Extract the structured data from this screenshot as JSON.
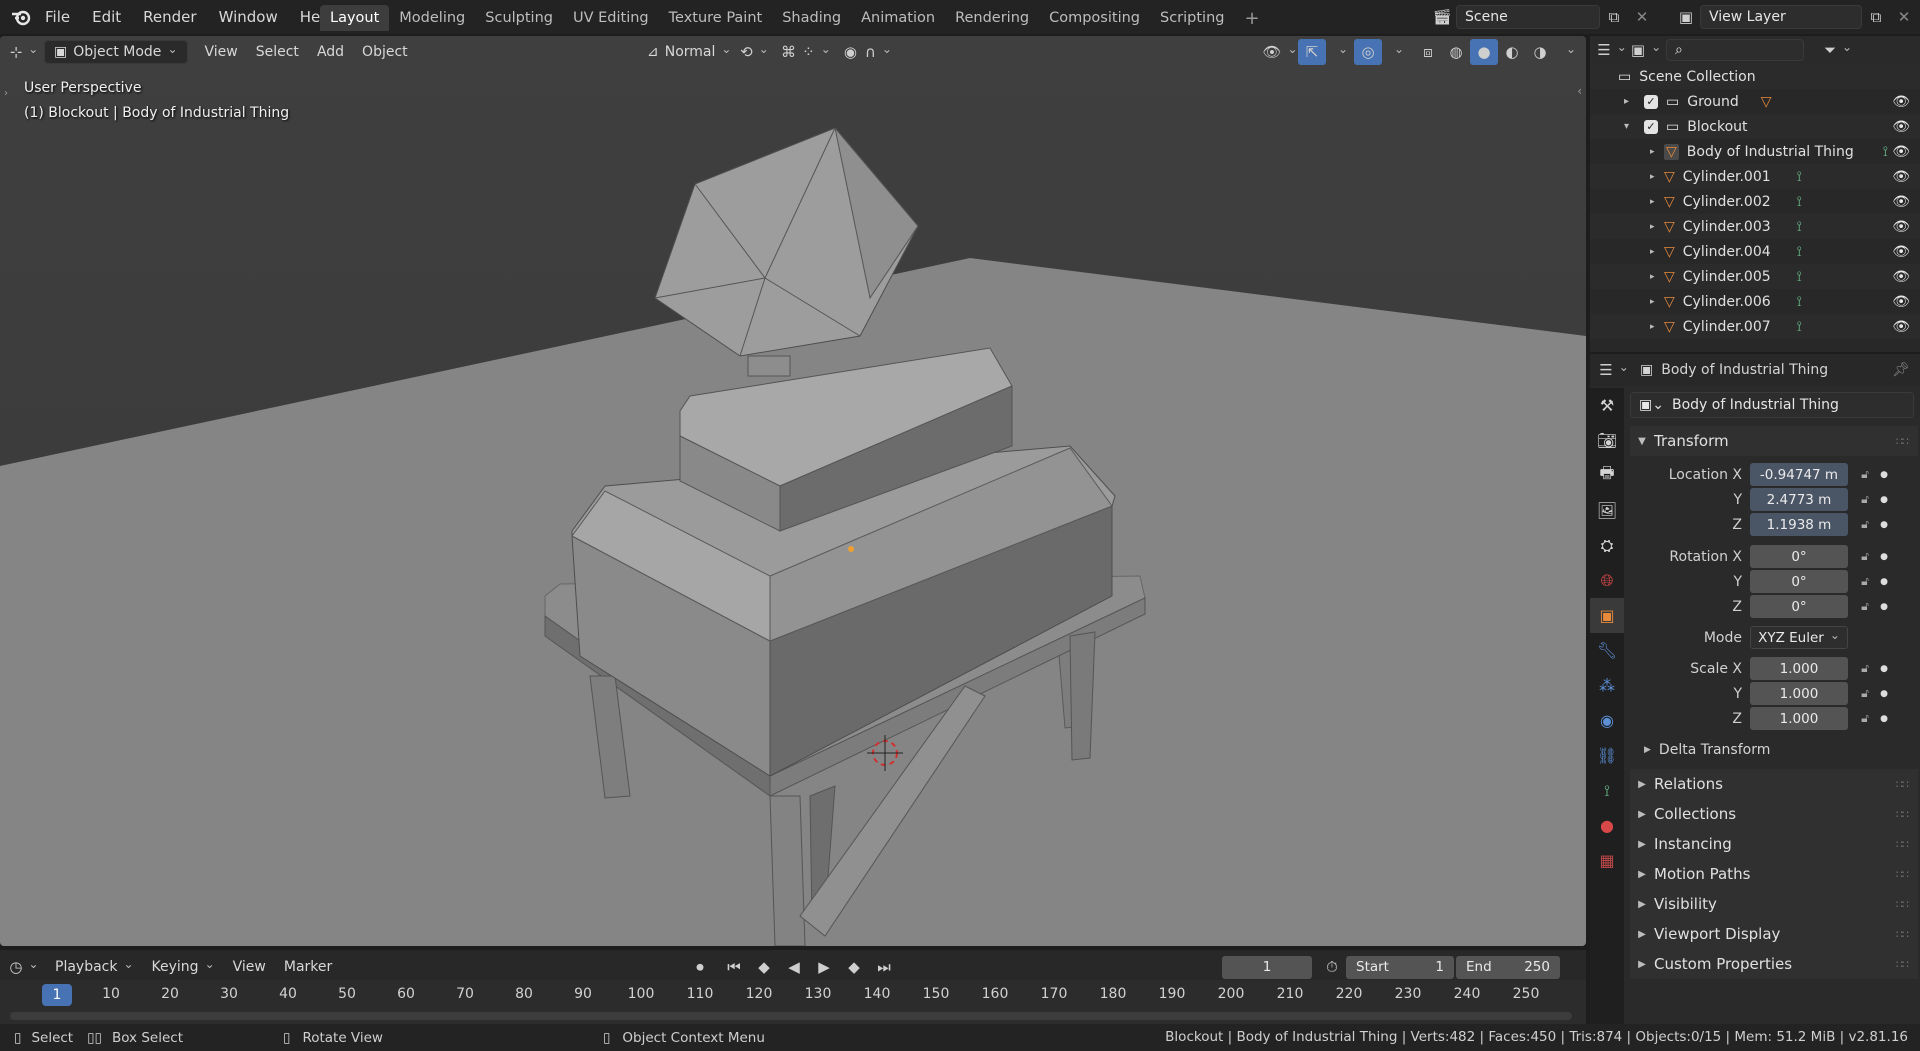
{
  "app": {
    "logo": "blender-logo-icon"
  },
  "menu": [
    "File",
    "Edit",
    "Render",
    "Window",
    "Help"
  ],
  "workspaces": [
    "Layout",
    "Modeling",
    "Sculpting",
    "UV Editing",
    "Texture Paint",
    "Shading",
    "Animation",
    "Rendering",
    "Compositing",
    "Scripting"
  ],
  "active_workspace": "Layout",
  "scene": {
    "name": "Scene",
    "view_layer": "View Layer"
  },
  "viewport": {
    "mode": "Object Mode",
    "menus": [
      "View",
      "Select",
      "Add",
      "Object"
    ],
    "orientation": "Normal",
    "perspective": "User Perspective",
    "active_info": "(1) Blockout | Body of Industrial Thing"
  },
  "outliner": {
    "root": "Scene Collection",
    "collections": [
      {
        "name": "Ground",
        "expanded": false
      },
      {
        "name": "Blockout",
        "expanded": true
      }
    ],
    "objects": [
      "Body of Industrial Thing",
      "Cylinder.001",
      "Cylinder.002",
      "Cylinder.003",
      "Cylinder.004",
      "Cylinder.005",
      "Cylinder.006",
      "Cylinder.007"
    ]
  },
  "properties": {
    "object_name": "Body of Industrial Thing",
    "data_name": "Body of Industrial Thing",
    "transform_title": "Transform",
    "location": {
      "label": "Location X",
      "x": "-0.94747 m",
      "y": "2.4773 m",
      "z": "1.1938 m"
    },
    "rotation": {
      "label": "Rotation X",
      "x": "0°",
      "y": "0°",
      "z": "0°"
    },
    "mode_label": "Mode",
    "mode_value": "XYZ Euler",
    "scale": {
      "label": "Scale X",
      "x": "1.000",
      "y": "1.000",
      "z": "1.000"
    },
    "axis_y": "Y",
    "axis_z": "Z",
    "delta": "Delta Transform",
    "panels": [
      "Relations",
      "Collections",
      "Instancing",
      "Motion Paths",
      "Visibility",
      "Viewport Display",
      "Custom Properties"
    ]
  },
  "timeline": {
    "menus": [
      "Playback",
      "Keying",
      "View",
      "Marker"
    ],
    "current_frame": "1",
    "start_label": "Start",
    "start": "1",
    "end_label": "End",
    "end": "250",
    "ticks": [
      "1",
      "10",
      "20",
      "30",
      "40",
      "50",
      "60",
      "70",
      "80",
      "90",
      "100",
      "110",
      "120",
      "130",
      "140",
      "150",
      "160",
      "170",
      "180",
      "190",
      "200",
      "210",
      "220",
      "230",
      "240",
      "250"
    ]
  },
  "status": {
    "select": "Select",
    "box_select": "Box Select",
    "rotate": "Rotate View",
    "context": "Object Context Menu",
    "info": "Blockout | Body of Industrial Thing | Verts:482 | Faces:450 | Tris:874 | Objects:0/15 | Mem: 51.2 MiB | v2.81.16"
  },
  "colors": {
    "accent": "#4772b3",
    "mesh_orange": "#e78a3a",
    "mesh_green": "#6bbf8c",
    "active_tab": "#3d3d3d"
  }
}
